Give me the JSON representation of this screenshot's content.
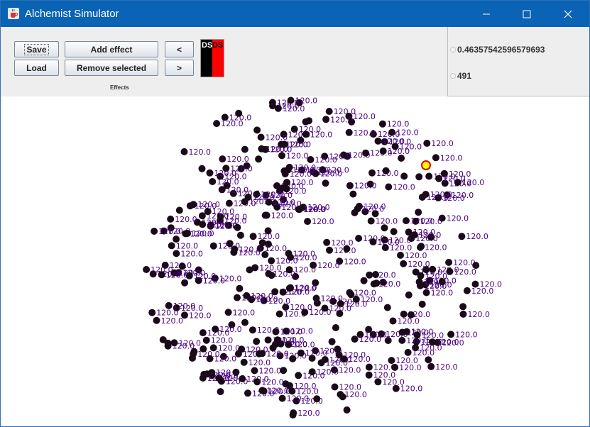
{
  "window": {
    "title": "Alchemist Simulator",
    "title_icon": "java-coffee-icon"
  },
  "toolbar": {
    "save_label": "Save",
    "load_label": "Load",
    "add_effect_label": "Add effect",
    "remove_selected_label": "Remove selected",
    "prev_label": "<",
    "next_label": ">",
    "effects_label": "Effects",
    "ds_left": "DS",
    "ds_right": "DS"
  },
  "side_panel": {
    "value1": "0.46357542596579693",
    "value2": "491"
  },
  "canvas": {
    "label_text": "120.0",
    "dot_color": "#1a0a1a",
    "label_color": "#4b0082",
    "highlight_color": "#ffff00",
    "highlight_border": "#e00000"
  },
  "colors": {
    "titlebar": "#0a63b4",
    "panel": "#eeeeee"
  }
}
